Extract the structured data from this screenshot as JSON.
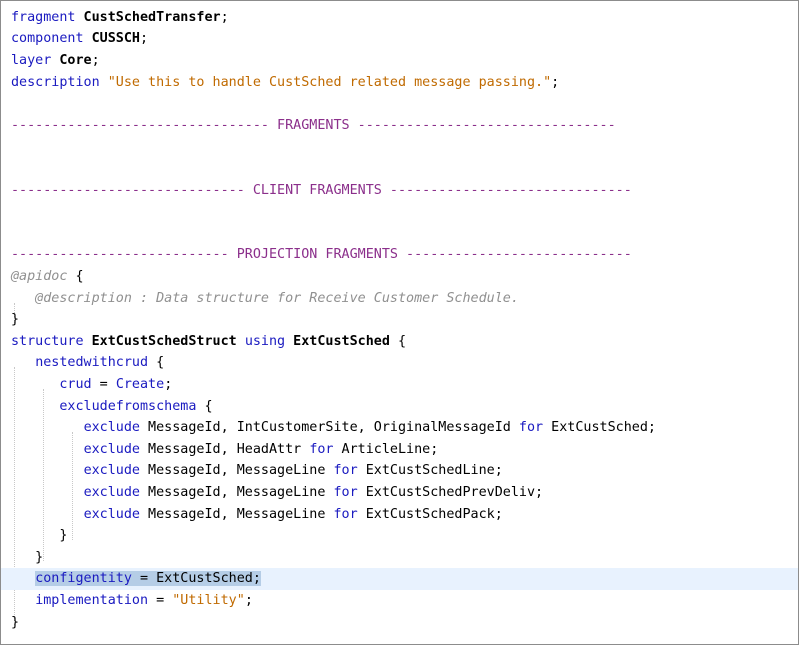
{
  "editor": {
    "lines": [
      {
        "tokens": [
          {
            "c": "kw",
            "t": "fragment"
          },
          {
            "c": "idb",
            "t": " CustSchedTransfer"
          },
          {
            "c": "punc",
            "t": ";"
          }
        ]
      },
      {
        "tokens": [
          {
            "c": "kw",
            "t": "component"
          },
          {
            "c": "idb",
            "t": " CUSSCH"
          },
          {
            "c": "punc",
            "t": ";"
          }
        ]
      },
      {
        "tokens": [
          {
            "c": "kw",
            "t": "layer"
          },
          {
            "c": "idb",
            "t": " Core"
          },
          {
            "c": "punc",
            "t": ";"
          }
        ]
      },
      {
        "tokens": [
          {
            "c": "kw",
            "t": "description"
          },
          {
            "c": "punc",
            "t": " "
          },
          {
            "c": "str",
            "t": "\"Use this to handle CustSched related message passing.\""
          },
          {
            "c": "punc",
            "t": ";"
          }
        ]
      },
      {
        "tokens": []
      },
      {
        "tokens": [
          {
            "c": "sec",
            "t": "-------------------------------- FRAGMENTS --------------------------------"
          }
        ]
      },
      {
        "tokens": []
      },
      {
        "tokens": []
      },
      {
        "tokens": [
          {
            "c": "sec",
            "t": "----------------------------- CLIENT FRAGMENTS ------------------------------"
          }
        ]
      },
      {
        "tokens": []
      },
      {
        "tokens": []
      },
      {
        "tokens": [
          {
            "c": "sec",
            "t": "--------------------------- PROJECTION FRAGMENTS ----------------------------"
          }
        ]
      },
      {
        "tokens": [
          {
            "c": "anno",
            "t": "@apidoc"
          },
          {
            "c": "punc",
            "t": " {"
          }
        ]
      },
      {
        "tokens": [
          {
            "c": "anno",
            "t": "   @description : Data structure for Receive Customer Schedule."
          }
        ]
      },
      {
        "tokens": [
          {
            "c": "punc",
            "t": "}"
          }
        ]
      },
      {
        "tokens": [
          {
            "c": "kw",
            "t": "structure"
          },
          {
            "c": "idb",
            "t": " ExtCustSchedStruct"
          },
          {
            "c": "punc",
            "t": " "
          },
          {
            "c": "kw",
            "t": "using"
          },
          {
            "c": "idb",
            "t": " ExtCustSched"
          },
          {
            "c": "punc",
            "t": " {"
          }
        ]
      },
      {
        "tokens": [
          {
            "c": "punc",
            "t": "   "
          },
          {
            "c": "kw",
            "t": "nestedwithcrud"
          },
          {
            "c": "punc",
            "t": " {"
          }
        ]
      },
      {
        "tokens": [
          {
            "c": "punc",
            "t": "      "
          },
          {
            "c": "kw",
            "t": "crud"
          },
          {
            "c": "punc",
            "t": " = "
          },
          {
            "c": "kw",
            "t": "Create"
          },
          {
            "c": "punc",
            "t": ";"
          }
        ]
      },
      {
        "tokens": [
          {
            "c": "punc",
            "t": "      "
          },
          {
            "c": "kw",
            "t": "excludefromschema"
          },
          {
            "c": "punc",
            "t": " {"
          }
        ]
      },
      {
        "tokens": [
          {
            "c": "punc",
            "t": "         "
          },
          {
            "c": "kw",
            "t": "exclude"
          },
          {
            "c": "id",
            "t": " MessageId, IntCustomerSite, OriginalMessageId "
          },
          {
            "c": "kw",
            "t": "for"
          },
          {
            "c": "id",
            "t": " ExtCustSched;"
          }
        ]
      },
      {
        "tokens": [
          {
            "c": "punc",
            "t": "         "
          },
          {
            "c": "kw",
            "t": "exclude"
          },
          {
            "c": "id",
            "t": " MessageId, HeadAttr "
          },
          {
            "c": "kw",
            "t": "for"
          },
          {
            "c": "id",
            "t": " ArticleLine;"
          }
        ]
      },
      {
        "tokens": [
          {
            "c": "punc",
            "t": "         "
          },
          {
            "c": "kw",
            "t": "exclude"
          },
          {
            "c": "id",
            "t": " MessageId, MessageLine "
          },
          {
            "c": "kw",
            "t": "for"
          },
          {
            "c": "id",
            "t": " ExtCustSchedLine;"
          }
        ]
      },
      {
        "tokens": [
          {
            "c": "punc",
            "t": "         "
          },
          {
            "c": "kw",
            "t": "exclude"
          },
          {
            "c": "id",
            "t": " MessageId, MessageLine "
          },
          {
            "c": "kw",
            "t": "for"
          },
          {
            "c": "id",
            "t": " ExtCustSchedPrevDeliv;"
          }
        ]
      },
      {
        "tokens": [
          {
            "c": "punc",
            "t": "         "
          },
          {
            "c": "kw",
            "t": "exclude"
          },
          {
            "c": "id",
            "t": " MessageId, MessageLine "
          },
          {
            "c": "kw",
            "t": "for"
          },
          {
            "c": "id",
            "t": " ExtCustSchedPack;"
          }
        ]
      },
      {
        "tokens": [
          {
            "c": "punc",
            "t": "      }"
          }
        ]
      },
      {
        "tokens": [
          {
            "c": "punc",
            "t": "   }"
          }
        ]
      },
      {
        "tokens": [
          {
            "c": "punc",
            "t": "   "
          },
          {
            "c": "kw sel",
            "t": "configentity"
          },
          {
            "c": "punc sel",
            "t": " = "
          },
          {
            "c": "id sel",
            "t": "ExtCustSched"
          },
          {
            "c": "punc sel",
            "t": ";"
          }
        ],
        "highlighted": true
      },
      {
        "tokens": [
          {
            "c": "punc",
            "t": "   "
          },
          {
            "c": "kw",
            "t": "implementation"
          },
          {
            "c": "punc",
            "t": " = "
          },
          {
            "c": "str",
            "t": "\"Utility\""
          },
          {
            "c": "punc",
            "t": ";"
          }
        ]
      },
      {
        "tokens": [
          {
            "c": "punc",
            "t": "}"
          }
        ]
      }
    ]
  }
}
